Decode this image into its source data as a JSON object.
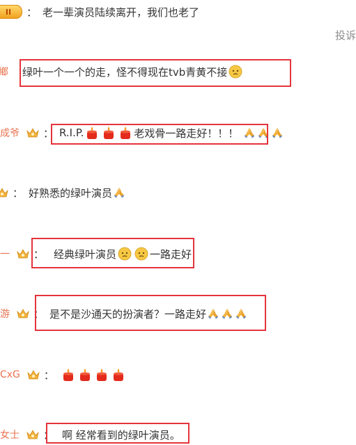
{
  "report_label": "投诉",
  "comments": [
    {
      "user": "",
      "badge": "II",
      "text": "老一辈演员陆续离开，我们也老了"
    },
    {
      "user": "鄉",
      "text": "绿叶一个一个的走，怪不得现在tvb青黄不接"
    },
    {
      "user": "成爷",
      "text_before": "R.I.P.",
      "text_after": "老戏骨一路走好！！！"
    },
    {
      "user": "",
      "text": "好熟悉的绿叶演员"
    },
    {
      "user": "一",
      "text_before": "经典绿叶演员",
      "text_after": "一路走好"
    },
    {
      "user": "游",
      "text": "是不是沙通天的扮演者？一路走好"
    },
    {
      "user": "CxG",
      "text": ""
    },
    {
      "user": "女士",
      "text": "啊 经常看到的绿叶演员。"
    }
  ],
  "colors": {
    "username": "#eb7350",
    "highlight": "#e5333b",
    "text": "#333333"
  }
}
